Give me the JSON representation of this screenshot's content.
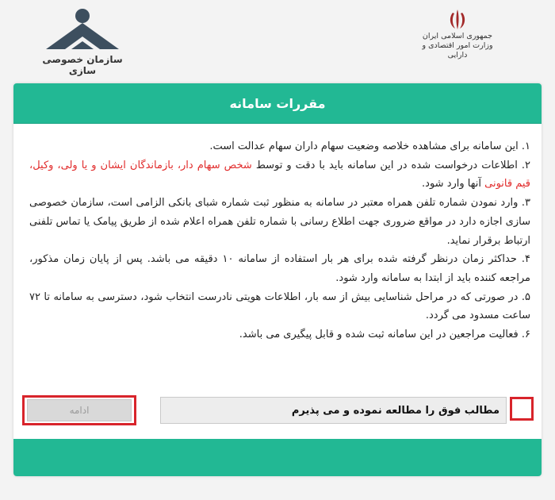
{
  "header": {
    "org_name": "سازمان خصوصی سازی",
    "gov_line1": "جمهوری اسلامی ایران",
    "gov_line2": "وزارت امور اقتصادی و دارایی"
  },
  "panel": {
    "title": "مقررات سامانه",
    "rules": [
      {
        "prefix": "۱. ",
        "text": "این سامانه برای مشاهده خلاصه وضعیت سهام داران سهام عدالت است.",
        "highlight": "",
        "suffix": ""
      },
      {
        "prefix": "۲. ",
        "text": "اطلاعات درخواست شده در این سامانه باید با دقت و توسط ",
        "highlight": "شخص سهام دار، بازماندگان ایشان و یا ولی، وکیل، قیم قانونی",
        "suffix": " آنها وارد شود."
      },
      {
        "prefix": "۳. ",
        "text": "وارد نمودن شماره تلفن همراه معتبر در سامانه به منظور ثبت شماره شبای بانکی الزامی است، سازمان خصوصی سازی اجازه دارد در مواقع ضروری جهت اطلاع رسانی با شماره تلفن همراه اعلام شده از طریق پیامک یا تماس تلفنی ارتباط برقرار نماید.",
        "highlight": "",
        "suffix": ""
      },
      {
        "prefix": "۴. ",
        "text": "حداکثر زمان درنظر گرفته شده برای هر بار استفاده از سامانه ۱۰ دقیقه می باشد. پس از پایان زمان مذکور، مراجعه کننده باید از ابتدا به سامانه وارد شود.",
        "highlight": "",
        "suffix": ""
      },
      {
        "prefix": "۵. ",
        "text": "در صورتی که در مراحل شناسایی بیش از سه بار، اطلاعات هویتی نادرست انتخاب شود، دسترسی به سامانه تا ۷۲ ساعت مسدود می گردد.",
        "highlight": "",
        "suffix": ""
      },
      {
        "prefix": "۶. ",
        "text": "فعالیت مراجعین در این سامانه ثبت شده و قابل پیگیری می باشد.",
        "highlight": "",
        "suffix": ""
      }
    ],
    "agree_label": "مطالب فوق را مطالعه نموده و می پذیرم",
    "agree_checked": false,
    "continue_label": "ادامه"
  },
  "colors": {
    "accent": "#22b894",
    "highlight": "#e12b2b",
    "outline": "#d8242b",
    "logo": "#3d4f5f"
  }
}
